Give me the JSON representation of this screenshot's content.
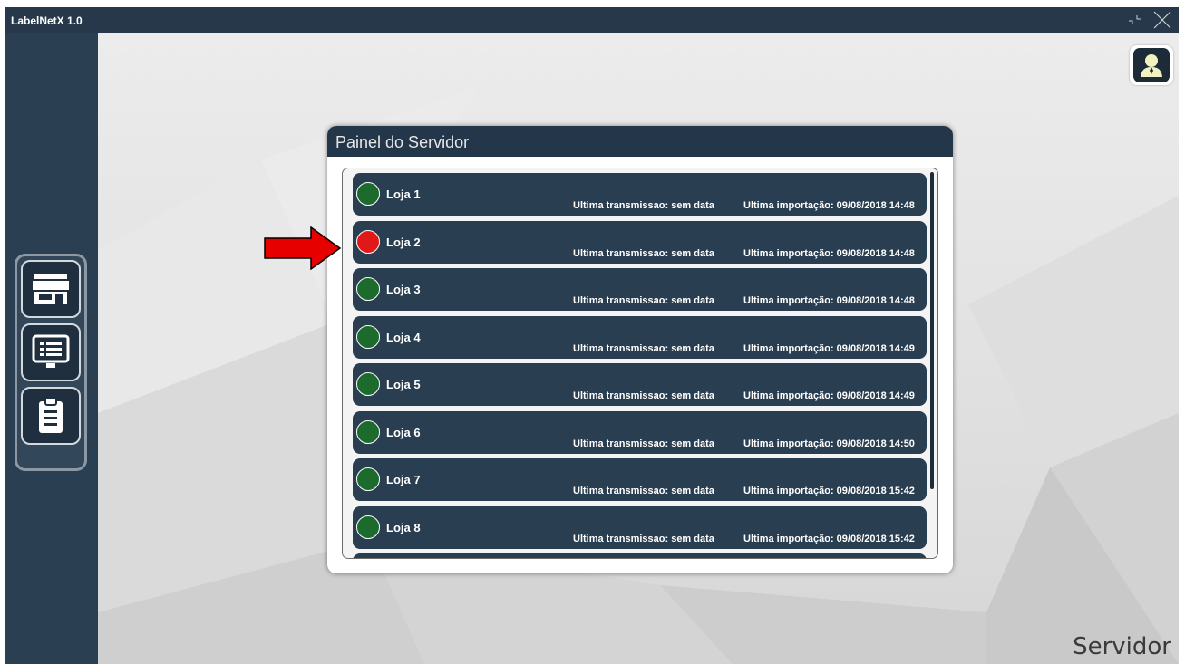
{
  "window": {
    "title": "LabelNetX 1.0"
  },
  "panel": {
    "title": "Painel do Servidor"
  },
  "footer": {
    "page_label": "Servidor"
  },
  "colors": {
    "status_ok": "#1c6b2c",
    "status_error": "#e01818",
    "arrow": "#e60000"
  },
  "sidebar": {
    "items": [
      {
        "icon": "store-icon"
      },
      {
        "icon": "monitor-list-icon"
      },
      {
        "icon": "clipboard-icon"
      }
    ]
  },
  "stores": [
    {
      "name": "Loja 1",
      "status": "ok",
      "transmission": "Ultima transmissao:  sem data",
      "import": "Ultima importação: 09/08/2018 14:48"
    },
    {
      "name": "Loja 2",
      "status": "error",
      "transmission": "Ultima transmissao:  sem data",
      "import": "Ultima importação: 09/08/2018 14:48"
    },
    {
      "name": "Loja 3",
      "status": "ok",
      "transmission": "Ultima transmissao:  sem data",
      "import": "Ultima importação: 09/08/2018 14:48"
    },
    {
      "name": "Loja 4",
      "status": "ok",
      "transmission": "Ultima transmissao:  sem data",
      "import": "Ultima importação: 09/08/2018 14:49"
    },
    {
      "name": "Loja 5",
      "status": "ok",
      "transmission": "Ultima transmissao:  sem data",
      "import": "Ultima importação: 09/08/2018 14:49"
    },
    {
      "name": "Loja 6",
      "status": "ok",
      "transmission": "Ultima transmissao:  sem data",
      "import": "Ultima importação: 09/08/2018 14:50"
    },
    {
      "name": "Loja 7",
      "status": "ok",
      "transmission": "Ultima transmissao:  sem data",
      "import": "Ultima importação: 09/08/2018 15:42"
    },
    {
      "name": "Loja 8",
      "status": "ok",
      "transmission": "Ultima transmissao:  sem data",
      "import": "Ultima importação: 09/08/2018 15:42"
    }
  ]
}
